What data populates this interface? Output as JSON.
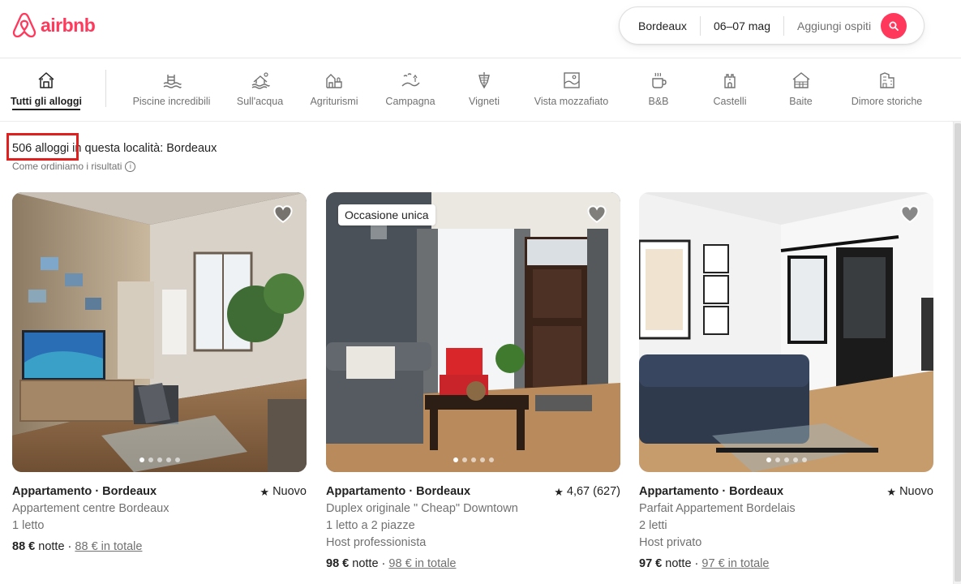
{
  "colors": {
    "brand": "#ff385c",
    "highlight_box": "#e0201f"
  },
  "header": {
    "logo_text": "airbnb",
    "search": {
      "location": "Bordeaux",
      "dates": "06–07 mag",
      "guests_placeholder": "Aggiungi ospiti"
    }
  },
  "categories": [
    {
      "label": "Tutti gli alloggi",
      "icon": "home-icon",
      "active": true
    },
    {
      "label": "Piscine incredibili",
      "icon": "pool-icon"
    },
    {
      "label": "Sull'acqua",
      "icon": "water-icon"
    },
    {
      "label": "Agriturismi",
      "icon": "farm-icon"
    },
    {
      "label": "Campagna",
      "icon": "countryside-icon"
    },
    {
      "label": "Vigneti",
      "icon": "grapes-icon"
    },
    {
      "label": "Vista mozzafiato",
      "icon": "view-icon"
    },
    {
      "label": "B&B",
      "icon": "coffee-icon"
    },
    {
      "label": "Castelli",
      "icon": "castle-icon"
    },
    {
      "label": "Baite",
      "icon": "cabin-icon"
    },
    {
      "label": "Dimore storiche",
      "icon": "historic-home-icon"
    }
  ],
  "results": {
    "count": "506 alloggi",
    "rest": " in questa località: Bordeaux",
    "sort_info": "Come ordiniamo i risultati"
  },
  "listings": [
    {
      "type": "Appartamento · Bordeaux",
      "rating": "Nuovo",
      "badge": "",
      "lines": [
        "Appartement centre Bordeaux",
        "1 letto"
      ],
      "price": "88 €",
      "price_unit": " notte · ",
      "total": "88 € in totale",
      "dots_active": 0
    },
    {
      "type": "Appartamento · Bordeaux",
      "rating": "4,67 (627)",
      "badge": "Occasione unica",
      "lines": [
        "Duplex originale \" Cheap\" Downtown",
        "1 letto a 2 piazze",
        "Host professionista"
      ],
      "price": "98 €",
      "price_unit": " notte · ",
      "total": "98 € in totale",
      "dots_active": 0
    },
    {
      "type": "Appartamento · Bordeaux",
      "rating": "Nuovo",
      "badge": "",
      "lines": [
        "Parfait Appartement Bordelais",
        "2 letti",
        "Host privato"
      ],
      "price": "97 €",
      "price_unit": " notte · ",
      "total": "97 € in totale",
      "dots_active": 0
    }
  ]
}
